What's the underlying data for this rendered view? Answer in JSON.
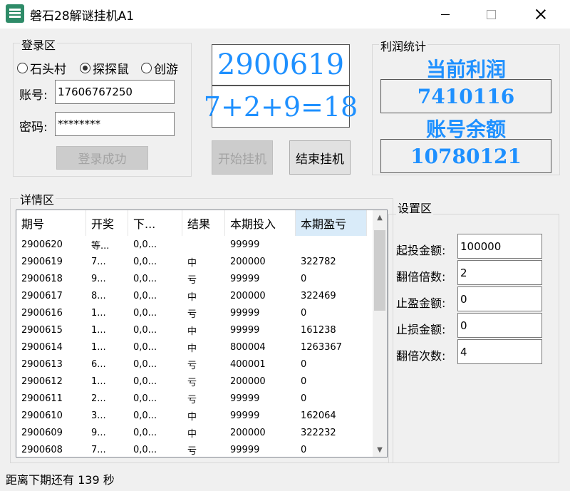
{
  "window": {
    "title": "磐石28解谜挂机A1"
  },
  "login": {
    "group_label": "登录区",
    "radios": [
      {
        "label": "石头村",
        "selected": false
      },
      {
        "label": "探探鼠",
        "selected": true
      },
      {
        "label": "创游",
        "selected": false
      }
    ],
    "account_label": "账号:",
    "account_value": "17606767250",
    "password_label": "密码:",
    "password_value": "********",
    "login_button": "登录成功"
  },
  "draw": {
    "period": "2900619",
    "formula": "7+2+9=18",
    "start_button": "开始挂机",
    "stop_button": "结束挂机"
  },
  "profit": {
    "group_label": "利润统计",
    "current_title": "当前利润",
    "current_value": "7410116",
    "balance_title": "账号余额",
    "balance_value": "10780121"
  },
  "details": {
    "group_label": "详情区",
    "columns": [
      "期号",
      "开奖",
      "下...",
      "结果",
      "本期投入",
      "本期盈亏"
    ],
    "rows": [
      [
        "2900620",
        "等...",
        "0,0...",
        "",
        "99999",
        ""
      ],
      [
        "2900619",
        "7...",
        "0,0...",
        "中",
        "200000",
        "322782"
      ],
      [
        "2900618",
        "9...",
        "0,0...",
        "亏",
        "99999",
        "0"
      ],
      [
        "2900617",
        "8...",
        "0,0...",
        "中",
        "200000",
        "322469"
      ],
      [
        "2900616",
        "1...",
        "0,0...",
        "亏",
        "99999",
        "0"
      ],
      [
        "2900615",
        "1...",
        "0,0...",
        "中",
        "99999",
        "161238"
      ],
      [
        "2900614",
        "1...",
        "0,0...",
        "中",
        "800004",
        "1263367"
      ],
      [
        "2900613",
        "6...",
        "0,0...",
        "亏",
        "400001",
        "0"
      ],
      [
        "2900612",
        "1...",
        "0,0...",
        "亏",
        "200000",
        "0"
      ],
      [
        "2900611",
        "2...",
        "0,0...",
        "亏",
        "99999",
        "0"
      ],
      [
        "2900610",
        "3...",
        "0,0...",
        "中",
        "99999",
        "162064"
      ],
      [
        "2900609",
        "9...",
        "0,0...",
        "中",
        "200000",
        "322232"
      ],
      [
        "2900608",
        "7...",
        "0,0...",
        "亏",
        "99999",
        "0"
      ]
    ]
  },
  "settings": {
    "group_label": "设置区",
    "fields": [
      {
        "label": "起投金额:",
        "value": "100000"
      },
      {
        "label": "翻倍倍数:",
        "value": "2"
      },
      {
        "label": "止盈金额:",
        "value": "0"
      },
      {
        "label": "止损金额:",
        "value": "0"
      },
      {
        "label": "翻倍次数:",
        "value": "4"
      }
    ]
  },
  "status": {
    "text": "距离下期还有 139 秒"
  },
  "colors": {
    "accent": "#1e90ff",
    "icon": "#2e8b68"
  }
}
